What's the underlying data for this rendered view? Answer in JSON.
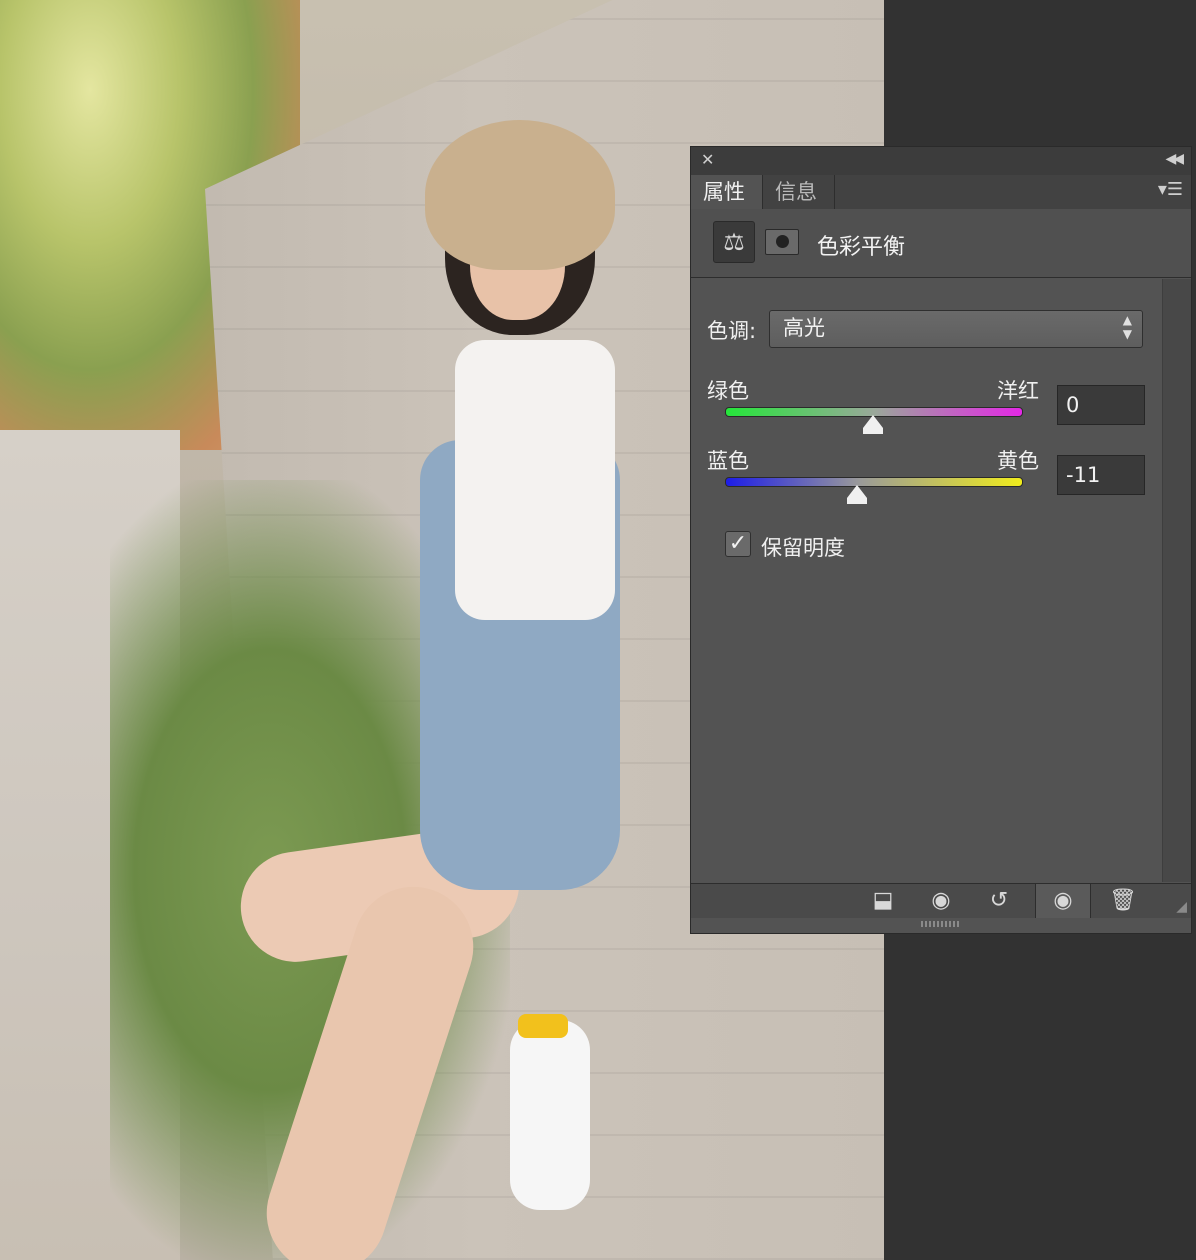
{
  "panel": {
    "tabs": [
      {
        "label": "属性",
        "active": true
      },
      {
        "label": "信息",
        "active": false
      }
    ],
    "adjustment_title": "色彩平衡",
    "tone_label": "色调:",
    "tone_value": "高光",
    "sliders": [
      {
        "left_label": "绿色",
        "right_label": "洋红",
        "value": "0",
        "position": 0.5
      },
      {
        "left_label": "蓝色",
        "right_label": "黄色",
        "value": "-11",
        "position": 0.445
      }
    ],
    "preserve_luminosity_label": "保留明度",
    "preserve_luminosity_checked": true,
    "icons": {
      "close": "close-icon",
      "collapse": "double-chevron-icon",
      "menu": "panel-menu-icon",
      "adjustment": "balance-scale-icon",
      "mask": "layer-mask-icon"
    },
    "footer_buttons": [
      "clip-to-layer-icon",
      "view-previous-state-icon",
      "reset-icon",
      "visibility-eye-icon",
      "trash-icon"
    ]
  },
  "colors": {
    "panel_bg": "#535353",
    "workspace_bg": "#323232",
    "green": "#25e63a",
    "magenta": "#e428e6",
    "blue": "#1d1de8",
    "yellow": "#f0ec1c"
  }
}
